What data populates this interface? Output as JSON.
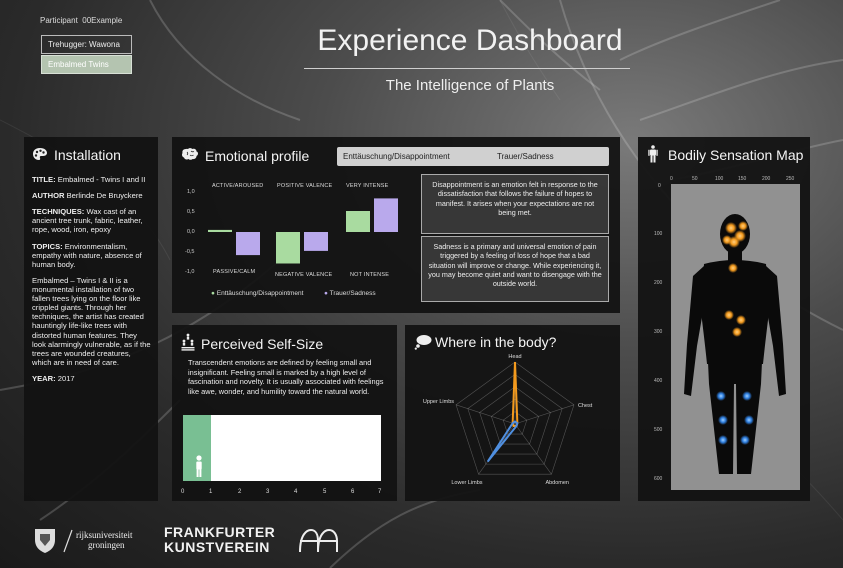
{
  "participant": {
    "label": "Participant",
    "id": "00Example"
  },
  "selectors": [
    {
      "label": "Trehugger: Wawona",
      "active": false
    },
    {
      "label": "Embalmed Twins",
      "active": true
    }
  ],
  "header": {
    "title": "Experience Dashboard",
    "subtitle": "The Intelligence of Plants"
  },
  "installation": {
    "title": "Installation",
    "title_label": "TITLE:",
    "title_value": "Embalmed - Twins I and II",
    "author_label": "AUTHOR",
    "author_value": "Berlinde De Bruyckere",
    "techniques_label": "TECHNIQUES:",
    "techniques_value": "Wax cast of an ancient tree trunk, fabric, leather, rope, wood, iron, epoxy",
    "topics_label": "TOPICS:",
    "topics_value": "Environmentalism, empathy with nature, absence of human body.",
    "description": "Embalmed – Twins I & II is a monumental installation of two fallen trees lying on the floor like crippled giants. Through her techniques, the artist has created hauntingly life-like trees with distorted human features. They look alarmingly vulnerable, as if the trees are wounded creatures, which are in need of care.",
    "year_label": "YEAR:",
    "year_value": "2017"
  },
  "emotional_profile": {
    "title": "Emotional profile",
    "tabs": [
      "Enttäuschung/Disappointment",
      "Trauer/Sadness"
    ],
    "desc_disappointment": "Disappointment is an emotion felt in response to the dissatisfaction that follows the failure of hopes to manifest. It arises when your expectations are not being met.",
    "desc_sadness": "Sadness is a primary and universal emotion of pain triggered by a feeling of loss of hope that a bad situation will improve or change. While experiencing it, you may become quiet and want to disengage with the outside world."
  },
  "chart_data": {
    "type": "bar",
    "top_labels": [
      "ACTIVE/AROUSED",
      "POSITIVE VALENCE",
      "VERY INTENSE"
    ],
    "bottom_labels": [
      "PASSIVE/CALM",
      "NEGATIVE VALENCE",
      "NOT INTENSE"
    ],
    "yticks": [
      "1,0",
      "0,5",
      "0,0",
      "-0,5",
      "-1,0"
    ],
    "ylim": [
      -1,
      1
    ],
    "series": [
      {
        "name": "Enttäuschung/Disappointment",
        "color": "#a9dba0",
        "values": [
          0.05,
          -0.75,
          0.5
        ]
      },
      {
        "name": "Trauer/Sadness",
        "color": "#b9a9ec",
        "values": [
          -0.55,
          -0.45,
          0.8
        ]
      }
    ]
  },
  "self_size": {
    "title": "Perceived Self-Size",
    "text": "Transcendent emotions are defined by feeling small and insignificant. Feeling small is marked by a high level of fascination and novelty. It is usually associated with feelings like awe, wonder, and humility toward the natural world.",
    "ticks": [
      "0",
      "1",
      "2",
      "3",
      "4",
      "5",
      "6",
      "7"
    ],
    "value": 1,
    "max": 7,
    "fill_color": "#79bf93"
  },
  "where_in_body": {
    "title": "Where in the body?",
    "axes": [
      "Head",
      "Chest",
      "Abdomen",
      "Lower Limbs",
      "Upper Limbs"
    ],
    "series": [
      {
        "color": "#f39a1e",
        "values": [
          1.0,
          0.0,
          0.0,
          0.0,
          0.0
        ]
      },
      {
        "color": "#4f8fe0",
        "values": [
          0.0,
          0.0,
          0.0,
          0.75,
          0.0
        ]
      }
    ]
  },
  "body_map": {
    "title": "Bodily Sensation Map",
    "x_ticks": [
      "0",
      "50",
      "100",
      "150",
      "200",
      "250"
    ],
    "y_ticks": [
      "0",
      "100",
      "200",
      "300",
      "400",
      "500",
      "600"
    ]
  },
  "logos": {
    "rug_line1": "rijksuniversiteit",
    "rug_line2": "groningen",
    "fk_line1": "FRANKFURTER",
    "fk_line2": "KUNSTVEREIN"
  }
}
